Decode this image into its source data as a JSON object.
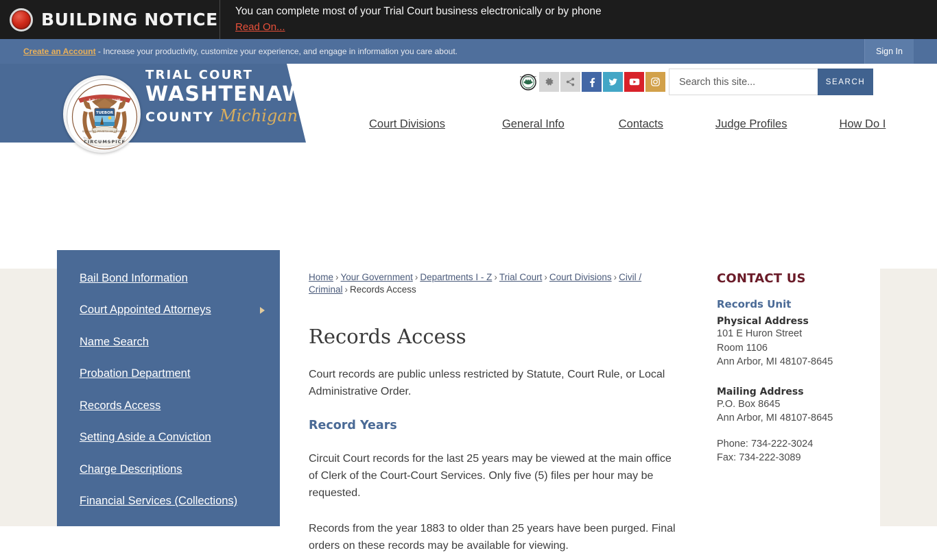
{
  "notice": {
    "icon": "alert-circle-icon",
    "title": "BUILDING NOTICE",
    "message": "You can complete most of your Trial Court business electronically or by phone",
    "read_on": "Read On..."
  },
  "account_bar": {
    "create_link": "Create an Account",
    "tagline": " - Increase your productivity, customize your experience, and engage in information you care about.",
    "sign_in": "Sign In"
  },
  "logo": {
    "line1": "TRIAL COURT",
    "line2": "WASHTENAW",
    "line3": "COUNTY",
    "line4": "Michigan",
    "watermark": "WASHTENAW COUNTY MICHIGAN",
    "seal_alt": "michigan-state-seal"
  },
  "utility_icons": [
    {
      "name": "county-seal-icon",
      "glyph": ""
    },
    {
      "name": "site-tools-gear-icon",
      "glyph": "⚙"
    },
    {
      "name": "share-icon",
      "glyph": "≪"
    },
    {
      "name": "facebook-icon",
      "glyph": "f"
    },
    {
      "name": "twitter-icon",
      "glyph": "ᵥ"
    },
    {
      "name": "youtube-icon",
      "glyph": "▶"
    },
    {
      "name": "instagram-icon",
      "glyph": "▢"
    }
  ],
  "search": {
    "placeholder": "Search this site...",
    "value": "",
    "button_label": "SEARCH"
  },
  "main_nav": [
    {
      "label": "Court Divisions"
    },
    {
      "label": "General Info"
    },
    {
      "label": "Contacts"
    },
    {
      "label": "Judge Profiles"
    },
    {
      "label": "How Do I"
    }
  ],
  "sidebar": {
    "items": [
      {
        "label": "Bail Bond Information",
        "has_submenu": false
      },
      {
        "label": "Court Appointed Attorneys",
        "has_submenu": true
      },
      {
        "label": "Name Search",
        "has_submenu": false
      },
      {
        "label": "Probation Department",
        "has_submenu": false
      },
      {
        "label": "Records Access",
        "has_submenu": false
      },
      {
        "label": "Setting Aside a Conviction",
        "has_submenu": false
      },
      {
        "label": "Charge Descriptions",
        "has_submenu": false
      },
      {
        "label": "Financial Services (Collections)",
        "has_submenu": false
      }
    ]
  },
  "breadcrumb": {
    "items": [
      {
        "label": "Home",
        "link": true
      },
      {
        "label": "Your Government",
        "link": true
      },
      {
        "label": "Departments I - Z",
        "link": true
      },
      {
        "label": "Trial Court",
        "link": true
      },
      {
        "label": "Court Divisions",
        "link": true
      },
      {
        "label": "Civil / Criminal",
        "link": true
      },
      {
        "label": "Records Access",
        "link": false
      }
    ],
    "separator": "›"
  },
  "main": {
    "title": "Records Access",
    "paragraph1": "Court records are public unless restricted by Statute, Court Rule, or Local Administrative Order.",
    "subheading1": "Record Years",
    "paragraph2": "Circuit Court records for the last 25 years may be viewed at the main office of Clerk of the Court-Court Services. Only five (5) files per hour may be requested.",
    "paragraph3": "Records from the year 1883 to older than 25 years have been purged. Final orders on these records may be available for viewing."
  },
  "contact": {
    "heading": "CONTACT US",
    "unit": "Records Unit",
    "physical_label": "Physical Address",
    "physical_line1": "101 E Huron Street",
    "physical_line2": "Room 1106",
    "physical_line3": "Ann Arbor, MI 48107-8645",
    "mailing_label": "Mailing Address",
    "mailing_line1": "P.O. Box 8645",
    "mailing_line2": "Ann Arbor, MI 48107-8645",
    "phone": "Phone: 734-222-3024",
    "fax": "Fax: 734-222-3089"
  },
  "colors": {
    "brand_blue": "#4a6a96",
    "dark_bar": "#1c1c1c",
    "accent_gold": "#d9ae5e",
    "alert_red": "#e8503a",
    "maroon": "#6a1b28",
    "beige": "#f2efe9"
  }
}
